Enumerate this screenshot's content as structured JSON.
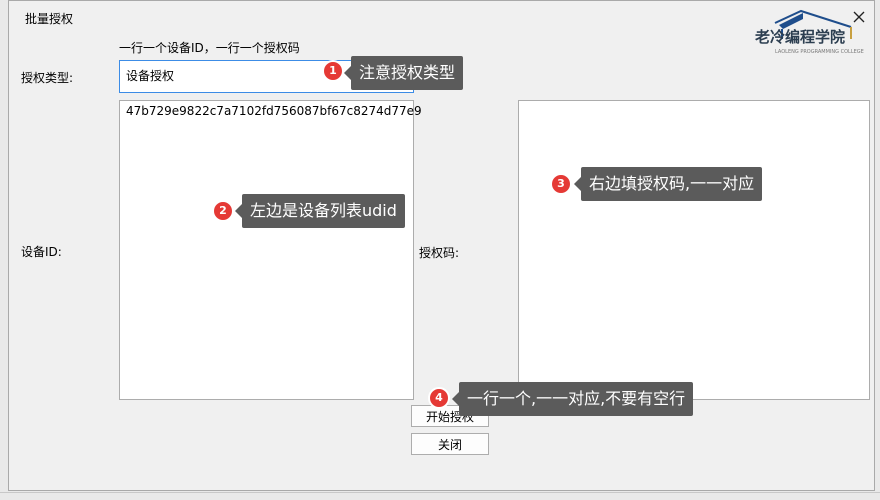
{
  "window": {
    "title": "批量授权",
    "close_glyph": "✕",
    "logo": {
      "text": "老冷编程学院",
      "sub": "LAOLENG PROGRAMMING COLLEGE"
    }
  },
  "form": {
    "hint": "一行一个设备ID，一行一个授权码",
    "type_label": "授权类型:",
    "type_value": "设备授权",
    "device_label": "设备ID:",
    "device_ids": "47b729e9822c7a7102fd756087bf67c8274d77e9",
    "code_label": "授权码:",
    "code_value": ""
  },
  "buttons": {
    "start": "开始授权",
    "close": "关闭"
  },
  "annotations": [
    {
      "num": "1",
      "text": "注意授权类型"
    },
    {
      "num": "2",
      "text": "左边是设备列表udid"
    },
    {
      "num": "3",
      "text": "右边填授权码,一一对应"
    },
    {
      "num": "4",
      "text": "一行一个,一一对应,不要有空行"
    }
  ],
  "colors": {
    "accent_border": "#3c8ce6",
    "callout_bg": "#5b5b5b",
    "badge_red": "#e53935"
  }
}
